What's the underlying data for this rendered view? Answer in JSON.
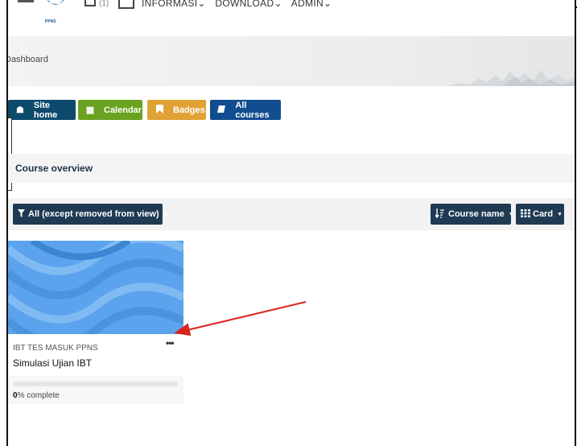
{
  "header": {
    "logo_text": "PPNS",
    "notification_count": "(1)",
    "menu": [
      "INFORMASI",
      "DOWNLOAD",
      "ADMIN"
    ]
  },
  "breadcrumb": "Dashboard",
  "quick_links": [
    {
      "label": "Site home",
      "icon": "home-icon",
      "color": "#0d4a6b"
    },
    {
      "label": "Calendar",
      "icon": "calendar-icon",
      "color": "#6aa321"
    },
    {
      "label": "Badges",
      "icon": "bookmark-icon",
      "color": "#e0a234"
    },
    {
      "label": "All courses",
      "icon": "book-icon",
      "color": "#124d8f"
    }
  ],
  "course_overview": {
    "title": "Course overview",
    "filter_label": "All (except removed from view)",
    "sort_label": "Course name",
    "view_label": "Card"
  },
  "courses": [
    {
      "category": "IBT TES MASUK PPNS",
      "name": "Simulasi Ujian IBT",
      "progress_percent": 0,
      "progress_value": "0",
      "progress_suffix": "% complete",
      "more_menu": "•••"
    }
  ]
}
